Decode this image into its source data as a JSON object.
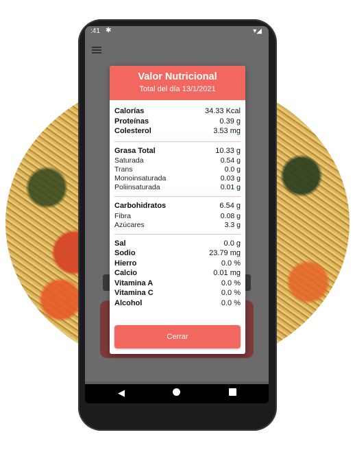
{
  "status_bar": {
    "time": ":41",
    "gear_icon": "gear-icon",
    "signal_icon": "signal-icon"
  },
  "modal": {
    "title": "Valor Nutricional",
    "subtitle": "Total del día 13/1/2021",
    "groups": [
      [
        {
          "label": "Calorías",
          "value": "34.33 Kcal",
          "bold": true
        },
        {
          "label": "Proteínas",
          "value": "0.39 g",
          "bold": true
        },
        {
          "label": "Colesterol",
          "value": "3.53 mg",
          "bold": true
        }
      ],
      [
        {
          "label": "Grasa Total",
          "value": "10.33 g",
          "bold": true
        },
        {
          "label": "Saturada",
          "value": "0.54 g",
          "bold": false
        },
        {
          "label": "Trans",
          "value": "0.0 g",
          "bold": false
        },
        {
          "label": "Monoinsaturada",
          "value": "0.03 g",
          "bold": false
        },
        {
          "label": "Poliinsaturada",
          "value": "0.01 g",
          "bold": false
        }
      ],
      [
        {
          "label": "Carbohidratos",
          "value": "6.54 g",
          "bold": true
        },
        {
          "label": "Fibra",
          "value": "0.08 g",
          "bold": false
        },
        {
          "label": "Azúcares",
          "value": "3.3 g",
          "bold": false
        }
      ],
      [
        {
          "label": "Sal",
          "value": "0.0 g",
          "bold": true
        },
        {
          "label": "Sodio",
          "value": "23.79 mg",
          "bold": true
        },
        {
          "label": "Hierro",
          "value": "0.0 %",
          "bold": true
        },
        {
          "label": "Calcio",
          "value": "0.01 mg",
          "bold": true
        },
        {
          "label": "Vitamina A",
          "value": "0.0 %",
          "bold": true
        },
        {
          "label": "Vitamina C",
          "value": "0.0 %",
          "bold": true
        },
        {
          "label": "Alcohol",
          "value": "0.0 %",
          "bold": true
        }
      ]
    ],
    "close_label": "Cerrar"
  },
  "colors": {
    "accent": "#f2675f",
    "overlay": "#6b6b6b"
  }
}
